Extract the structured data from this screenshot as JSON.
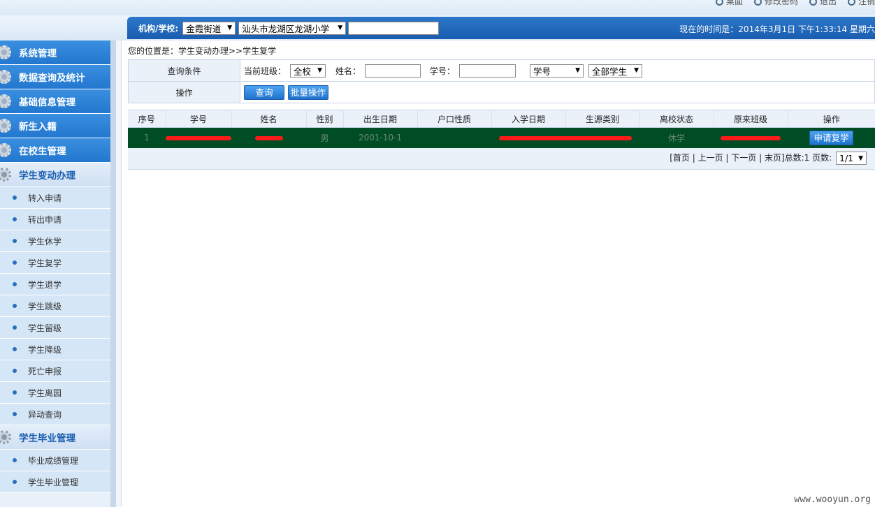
{
  "top_links": [
    "桌面",
    "修改密码",
    "退出",
    "注销"
  ],
  "navbar": {
    "org_label": "机构/学校:",
    "street_select": "金霞街道",
    "school_select": "汕头市龙湖区龙湖小学",
    "clock": "现在的时间是：2014年3月1日 下午1:33:14 星期六"
  },
  "sidebar": {
    "groups_top": [
      "系统管理",
      "数据查询及统计",
      "基础信息管理",
      "新生入籍",
      "在校生管理"
    ],
    "change_group": "学生变动办理",
    "change_items": [
      "转入申请",
      "转出申请",
      "学生休学",
      "学生复学",
      "学生退学",
      "学生跳级",
      "学生留级",
      "学生降级",
      "死亡申报",
      "学生离园",
      "异动查询"
    ],
    "grad_group": "学生毕业管理",
    "grad_items": [
      "毕业成绩管理",
      "学生毕业管理"
    ]
  },
  "main": {
    "breadcrumb": "您的位置是：学生变动办理>>学生复学",
    "query_head": "查询条件",
    "op_head": "操作",
    "class_label": "当前班级：",
    "class_value": "全校",
    "name_label": "姓名：",
    "id_label": "学号：",
    "sort_select": "学号",
    "scope_select": "全部学生",
    "query_button": "查询",
    "batch_button": "批量操作"
  },
  "grid": {
    "columns": [
      "序号",
      "学号",
      "姓名",
      "性别",
      "出生日期",
      "户口性质",
      "入学日期",
      "生源类别",
      "离校状态",
      "原来班级",
      "操作"
    ],
    "rows": [
      {
        "no": "1",
        "gender": "男",
        "birth": "2001-10-1",
        "status": "休学",
        "action": "申请复学"
      }
    ],
    "pager_text": "[首页 | 上一页 | 下一页 | 末页]总数:1 页数:",
    "page_select": "1/1"
  },
  "watermark": "www.wooyun.org"
}
